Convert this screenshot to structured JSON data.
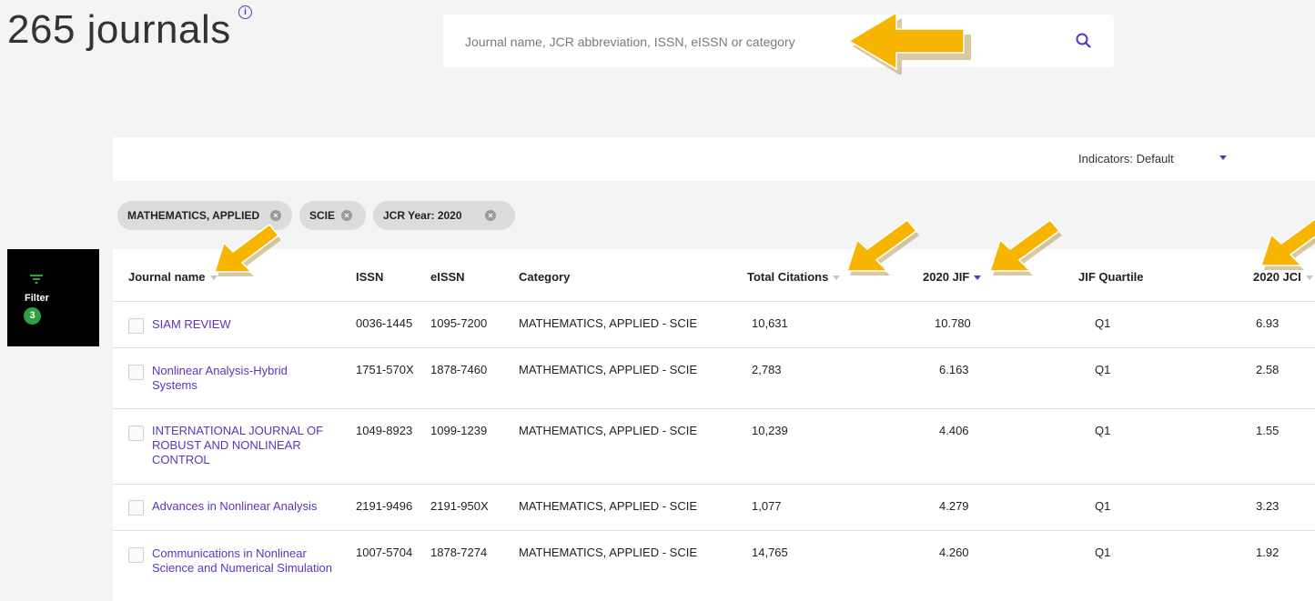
{
  "header": {
    "title": "265 journals",
    "info_icon": "info-icon",
    "search_placeholder": "Journal name, JCR abbreviation, ISSN, eISSN or category",
    "search_icon": "search-icon"
  },
  "toolbar": {
    "indicators_label": "Indicators: Default"
  },
  "filters": {
    "chips": [
      {
        "label": "MATHEMATICS, APPLIED"
      },
      {
        "label": "SCIE"
      },
      {
        "label": "JCR Year: 2020"
      }
    ]
  },
  "filter_panel": {
    "label": "Filter",
    "count": "3"
  },
  "table": {
    "columns": [
      "Journal name",
      "ISSN",
      "eISSN",
      "Category",
      "Total Citations",
      "2020 JIF",
      "JIF Quartile",
      "2020 JCI"
    ],
    "rows": [
      {
        "name": "SIAM REVIEW",
        "issn": "0036-1445",
        "eissn": "1095-7200",
        "category": "MATHEMATICS, APPLIED - SCIE",
        "citations": "10,631",
        "jif": "10.780",
        "quartile": "Q1",
        "jci": "6.93"
      },
      {
        "name": "Nonlinear Analysis-Hybrid Systems",
        "issn": "1751-570X",
        "eissn": "1878-7460",
        "category": "MATHEMATICS, APPLIED - SCIE",
        "citations": "2,783",
        "jif": "6.163",
        "quartile": "Q1",
        "jci": "2.58"
      },
      {
        "name": "INTERNATIONAL JOURNAL OF ROBUST AND NONLINEAR CONTROL",
        "issn": "1049-8923",
        "eissn": "1099-1239",
        "category": "MATHEMATICS, APPLIED - SCIE",
        "citations": "10,239",
        "jif": "4.406",
        "quartile": "Q1",
        "jci": "1.55"
      },
      {
        "name": "Advances in Nonlinear Analysis",
        "issn": "2191-9496",
        "eissn": "2191-950X",
        "category": "MATHEMATICS, APPLIED - SCIE",
        "citations": "1,077",
        "jif": "4.279",
        "quartile": "Q1",
        "jci": "3.23"
      },
      {
        "name": "Communications in Nonlinear Science and Numerical Simulation",
        "issn": "1007-5704",
        "eissn": "1878-7274",
        "category": "MATHEMATICS, APPLIED - SCIE",
        "citations": "14,765",
        "jif": "4.260",
        "quartile": "Q1",
        "jci": "1.92"
      }
    ]
  },
  "colors": {
    "accent": "#5e33bf",
    "annotation_arrow": "#f7b500",
    "badge": "#2ea043"
  }
}
